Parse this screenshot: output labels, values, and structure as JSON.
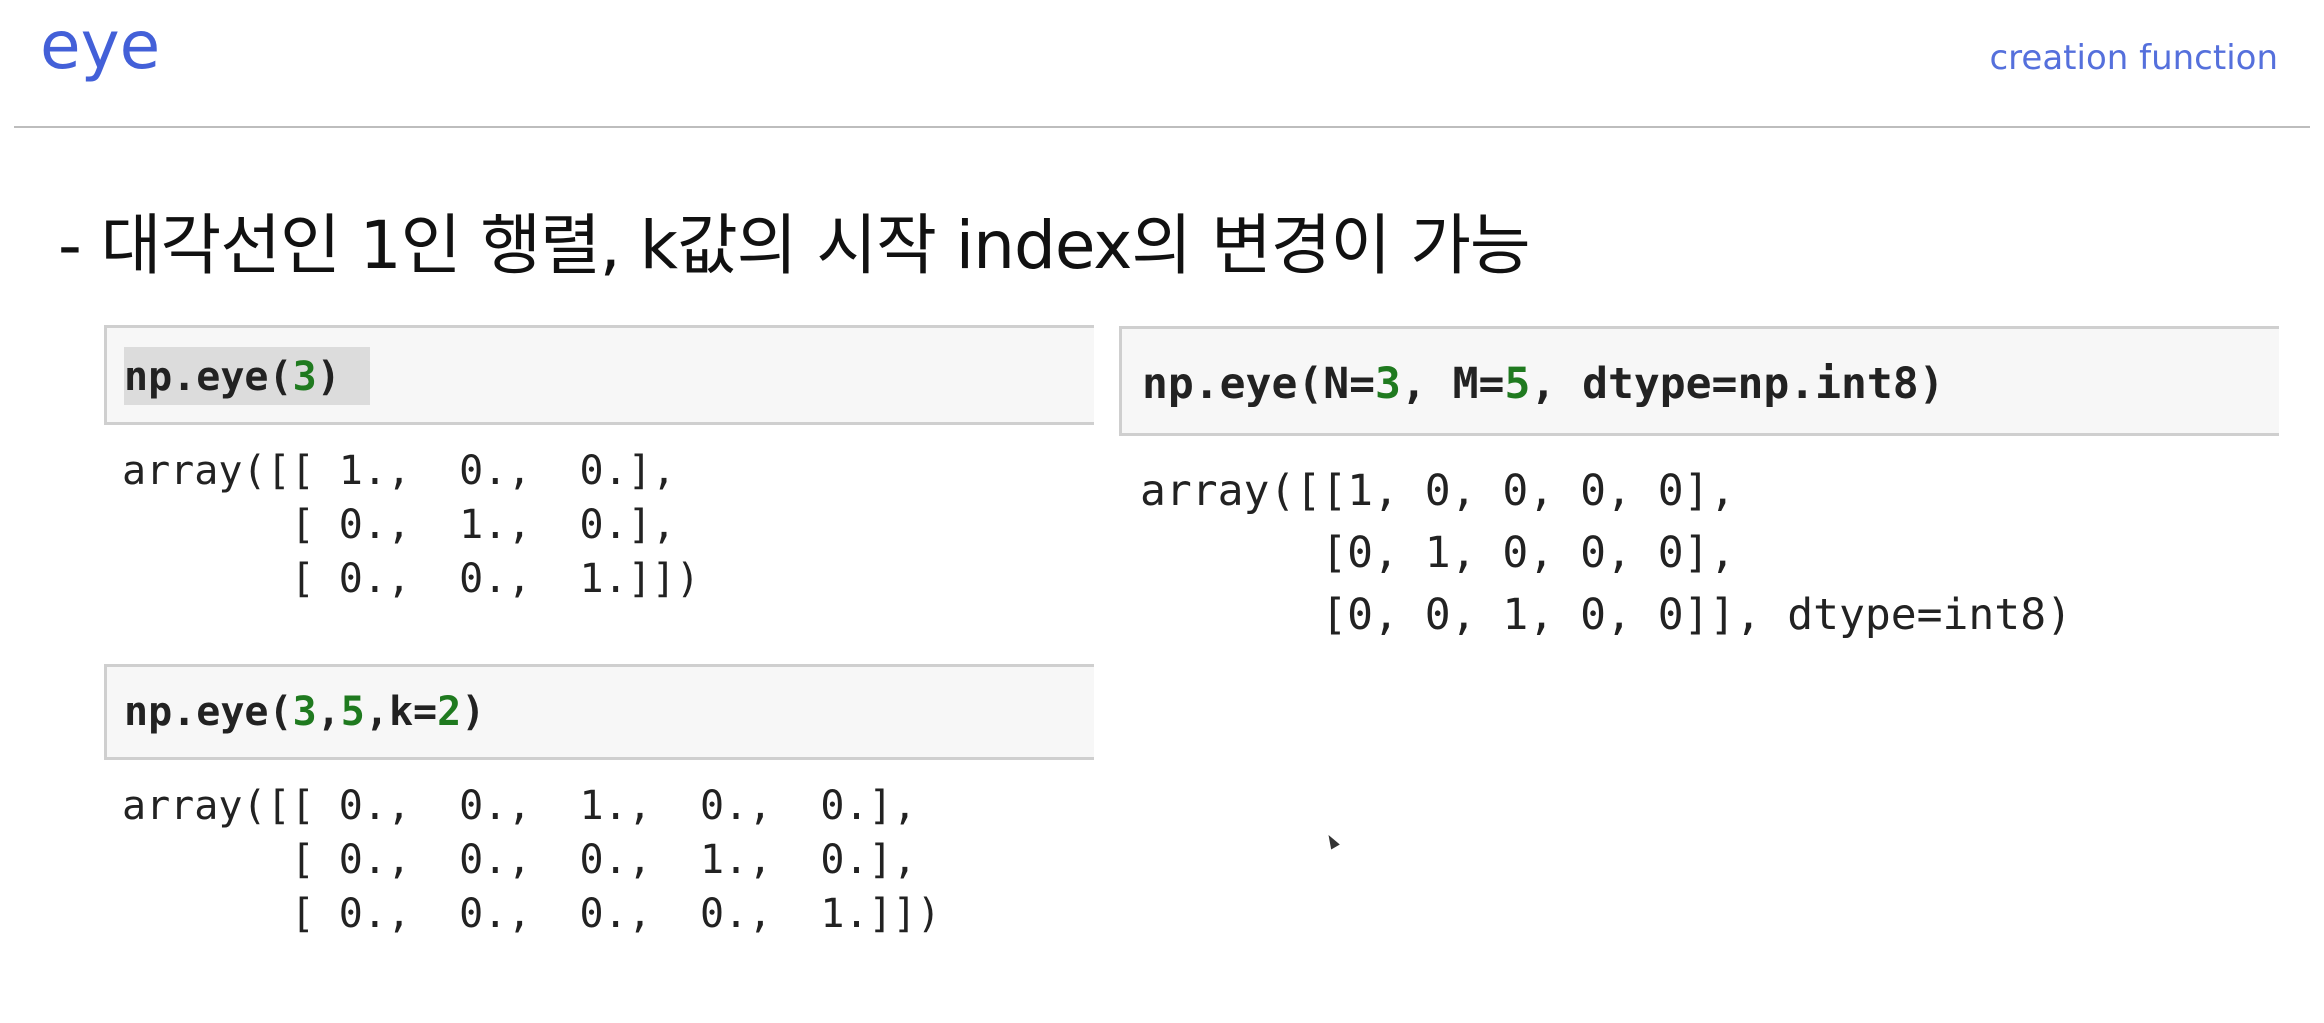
{
  "slide": {
    "title": "eye",
    "subtitle": "creation function",
    "bullet": "- 대각선인 1인 행렬, k값의 시작 index의 변경이 가능"
  },
  "cells": [
    {
      "input_parts": [
        "np.eye(",
        "3",
        ")"
      ],
      "output_lines": [
        "array([[ 1.,  0.,  0.],",
        "       [ 0.,  1.,  0.],",
        "       [ 0.,  0.,  1.]])"
      ]
    },
    {
      "input_parts": [
        "np.eye(",
        "3",
        ",",
        "5",
        ",k=",
        "2",
        ")"
      ],
      "output_lines": [
        "array([[ 0.,  0.,  1.,  0.,  0.],",
        "       [ 0.,  0.,  0.,  1.,  0.],",
        "       [ 0.,  0.,  0.,  0.,  1.]])"
      ]
    },
    {
      "input_parts": [
        "np.eye(N=",
        "3",
        ", M=",
        "5",
        ", dtype=np.int8)"
      ],
      "output_lines": [
        "array([[1, 0, 0, 0, 0],",
        "       [0, 1, 0, 0, 0],",
        "       [0, 0, 1, 0, 0]], dtype=int8)"
      ]
    }
  ],
  "colors": {
    "title": "#4360d8",
    "number": "#1f7a1f",
    "cell_background": "#f7f7f7"
  }
}
